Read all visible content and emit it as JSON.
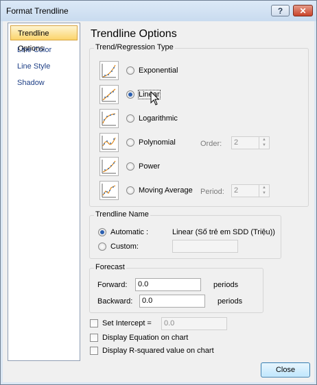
{
  "window": {
    "title": "Format Trendline"
  },
  "titlebar": {
    "help_label": "?",
    "close_label": "✕"
  },
  "nav": {
    "items": [
      {
        "label": "Trendline Options"
      },
      {
        "label": "Line Color"
      },
      {
        "label": "Line Style"
      },
      {
        "label": "Shadow"
      }
    ]
  },
  "panel": {
    "heading": "Trendline Options",
    "regression_group_title": "Trend/Regression Type",
    "types": [
      {
        "label": "Exponential",
        "selected": false
      },
      {
        "label": "Linear",
        "selected": true
      },
      {
        "label": "Logarithmic",
        "selected": false
      },
      {
        "label": "Polynomial",
        "selected": false
      },
      {
        "label": "Power",
        "selected": false
      },
      {
        "label": "Moving Average",
        "selected": false
      }
    ],
    "order": {
      "label": "Order:",
      "value": "2"
    },
    "period": {
      "label": "Period:",
      "value": "2"
    },
    "name_group": {
      "title": "Trendline Name",
      "automatic_label": "Automatic :",
      "automatic_value": "Linear (Số trẻ em SDD (Triệu))",
      "custom_label": "Custom:",
      "custom_value": ""
    },
    "forecast_group": {
      "title": "Forecast",
      "forward_label": "Forward:",
      "forward_value": "0.0",
      "forward_unit": "periods",
      "backward_label": "Backward:",
      "backward_value": "0.0",
      "backward_unit": "periods"
    },
    "intercept": {
      "label": "Set Intercept =",
      "value": "0.0"
    },
    "display_equation": {
      "label": "Display Equation on chart"
    },
    "display_r2": {
      "label": "Display R-squared value on chart"
    }
  },
  "footer": {
    "close_label": "Close"
  },
  "colors": {
    "accent": "#fbd46b",
    "nav_text": "#1e3f86",
    "radio_dot": "#2b5fb0"
  },
  "icons": [
    "exponential-icon",
    "linear-icon",
    "logarithmic-icon",
    "polynomial-icon",
    "power-icon",
    "moving-average-icon",
    "cursor-icon"
  ]
}
